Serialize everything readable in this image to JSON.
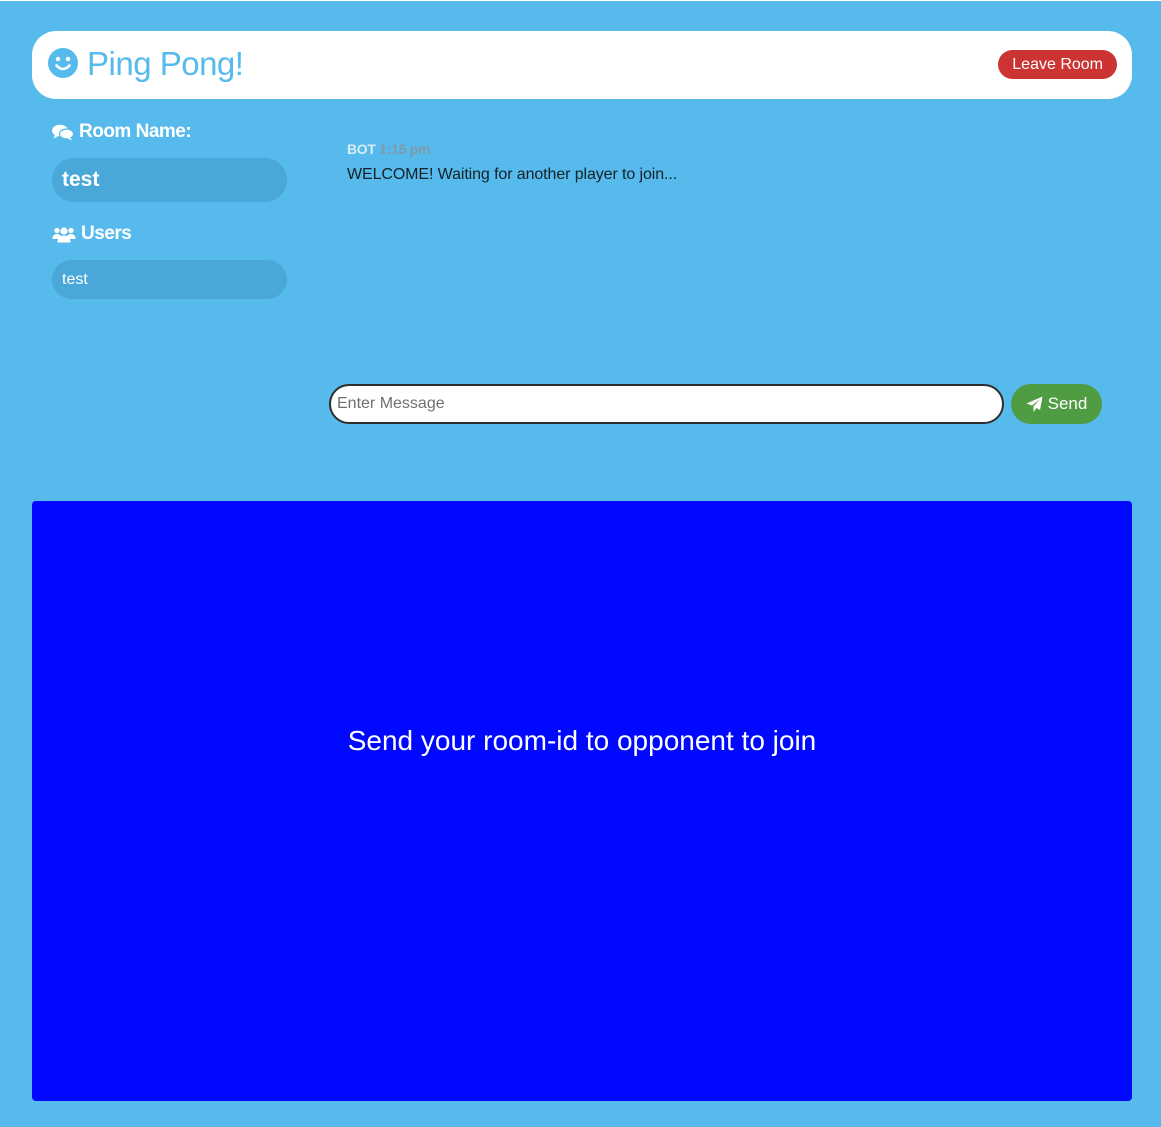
{
  "header": {
    "title": "Ping Pong!",
    "logo_icon": "smiley-face-icon",
    "leave_button_label": "Leave Room"
  },
  "sidebar": {
    "room_heading": "Room Name:",
    "room_icon": "comments-icon",
    "room_name": "test",
    "users_heading": "Users",
    "users_icon": "users-icon",
    "users": [
      "test"
    ]
  },
  "chat": {
    "messages": [
      {
        "user": "BOT",
        "time": "1:15 pm",
        "text": "WELCOME! Waiting for another player to join..."
      }
    ],
    "input_placeholder": "Enter Message",
    "input_value": "",
    "send_label": "Send",
    "send_icon": "paper-plane-icon"
  },
  "game": {
    "message": "Send your room-id to opponent to join"
  },
  "colors": {
    "background": "#56baec",
    "game_area": "#0008ff",
    "leave_button": "#cc3434",
    "send_button": "#4f9c43"
  }
}
